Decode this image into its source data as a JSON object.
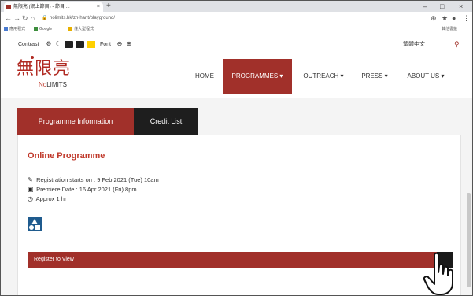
{
  "browser": {
    "tab_title": "無限亮 (網上節目) - 節目 ...",
    "tab_close": "×",
    "new_tab": "+",
    "minimize": "–",
    "maximize": "□",
    "close": "×",
    "url": "nolimits.hk/zh-hant/playground/",
    "bookmarks": [
      "應用程式",
      "Google",
      "僅大型程式"
    ],
    "bookmarks_right": "其他書籤"
  },
  "accessibility": {
    "contrast_label": "Contrast",
    "font_label": "Font",
    "language": "繁體中文"
  },
  "header": {
    "logo_cn": "無限亮",
    "logo_en_no": "No",
    "logo_en_limits": "LIMITS",
    "nav": [
      {
        "label": "HOME"
      },
      {
        "label": "PROGRAMMES ▾"
      },
      {
        "label": "OUTREACH ▾"
      },
      {
        "label": "PRESS ▾"
      },
      {
        "label": "ABOUT US ▾"
      }
    ]
  },
  "content": {
    "tabs": [
      "Programme Information",
      "Credit List"
    ],
    "title": "Online Programme",
    "registration": "Registration starts on : 9 Feb 2021 (Tue) 10am",
    "premiere": "Premiere Date : 16 Apr 2021 (Fri) 8pm",
    "duration": "Approx 1 hr",
    "register_label": "Register to View"
  },
  "colors": {
    "brand_red": "#a1302a",
    "dark": "#1e1e1e",
    "icon_blue": "#1f5b8e"
  }
}
